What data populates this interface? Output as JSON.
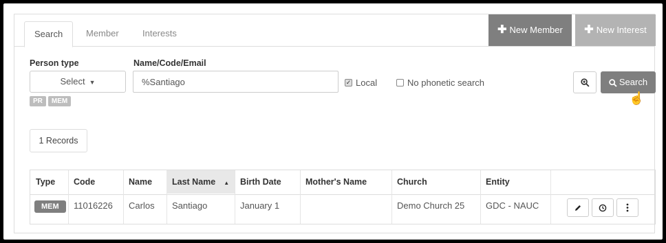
{
  "tabs": [
    {
      "label": "Search",
      "active": true
    },
    {
      "label": "Member",
      "active": false
    },
    {
      "label": "Interests",
      "active": false
    }
  ],
  "header_buttons": {
    "new_member": "New Member",
    "new_interest": "New Interest"
  },
  "form": {
    "person_type_label": "Person type",
    "person_type_value": "Select",
    "name_label": "Name/Code/Email",
    "name_value": "%Santiago",
    "local_label": "Local",
    "local_checked": true,
    "phonetic_label": "No phonetic search",
    "phonetic_checked": false,
    "badges": [
      "PR",
      "MEM"
    ]
  },
  "search_button": "Search",
  "records_label": "1 Records",
  "table": {
    "columns": [
      "Type",
      "Code",
      "Name",
      "Last Name",
      "Birth Date",
      "Mother's Name",
      "Church",
      "Entity"
    ],
    "rows": [
      {
        "type": "MEM",
        "code": "11016226",
        "name": "Carlos",
        "last_name": "Santiago",
        "birth_date": "January 1",
        "mothers_name": "",
        "church": "Demo Church 25",
        "entity": "GDC - NAUC"
      }
    ]
  },
  "colors": {
    "primary_button": "#7f7f7f",
    "disabled_button": "#b3b3b3",
    "badge": "#bdbdbd"
  }
}
